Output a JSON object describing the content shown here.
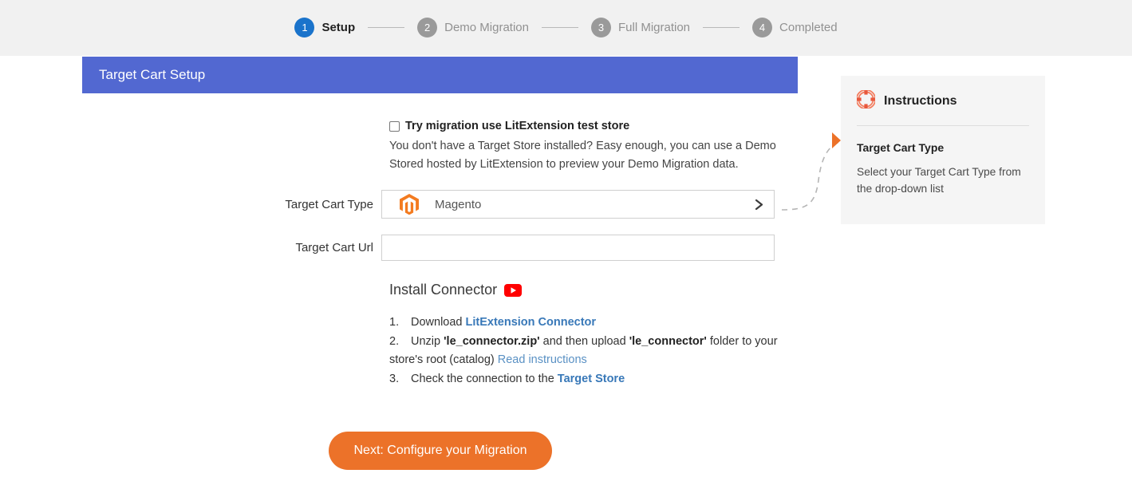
{
  "stepper": {
    "steps": [
      {
        "num": "1",
        "label": "Setup",
        "state": "active"
      },
      {
        "num": "2",
        "label": "Demo Migration",
        "state": "inactive"
      },
      {
        "num": "3",
        "label": "Full Migration",
        "state": "inactive"
      },
      {
        "num": "4",
        "label": "Completed",
        "state": "inactive"
      }
    ]
  },
  "section": {
    "title": "Target Cart Setup",
    "header_color": "#5268d1"
  },
  "demo_store": {
    "checkbox_label": "Try migration use LitExtension test store",
    "checkbox_checked": false,
    "description": "You don't have a Target Store installed? Easy enough, you can use a Demo Stored hosted by LitExtension to preview your Demo Migration data."
  },
  "cart_type": {
    "label": "Target Cart Type",
    "selected": "Magento",
    "icon": "magento-logo-icon",
    "chevron": "chevron-right-icon"
  },
  "cart_url": {
    "label": "Target Cart Url",
    "value": "",
    "placeholder": ""
  },
  "connector": {
    "title": "Install Connector",
    "video_icon": "youtube-play-icon",
    "steps": [
      {
        "index": "1.",
        "parts": [
          {
            "text": "Download ",
            "style": "plain"
          },
          {
            "text": "LitExtension Connector",
            "style": "link"
          }
        ]
      },
      {
        "index": "2.",
        "parts": [
          {
            "text": "Unzip ",
            "style": "plain"
          },
          {
            "text": "'le_connector.zip'",
            "style": "bold"
          },
          {
            "text": " and then upload ",
            "style": "plain"
          },
          {
            "text": "'le_connector'",
            "style": "bold"
          },
          {
            "text": " folder to your store's root (catalog) ",
            "style": "plain"
          },
          {
            "text": "Read instructions",
            "style": "link-plain"
          }
        ]
      },
      {
        "index": "3.",
        "parts": [
          {
            "text": "Check the connection to the ",
            "style": "plain"
          },
          {
            "text": "Target Store",
            "style": "link"
          }
        ]
      }
    ]
  },
  "next_button": {
    "label": "Next: Configure your Migration",
    "color": "#ec7229"
  },
  "instructions": {
    "icon": "lifebuoy-icon",
    "title": "Instructions",
    "subtitle": "Target Cart Type",
    "body": "Select your Target Cart Type from the drop-down list",
    "accent_color": "#ec7229"
  }
}
